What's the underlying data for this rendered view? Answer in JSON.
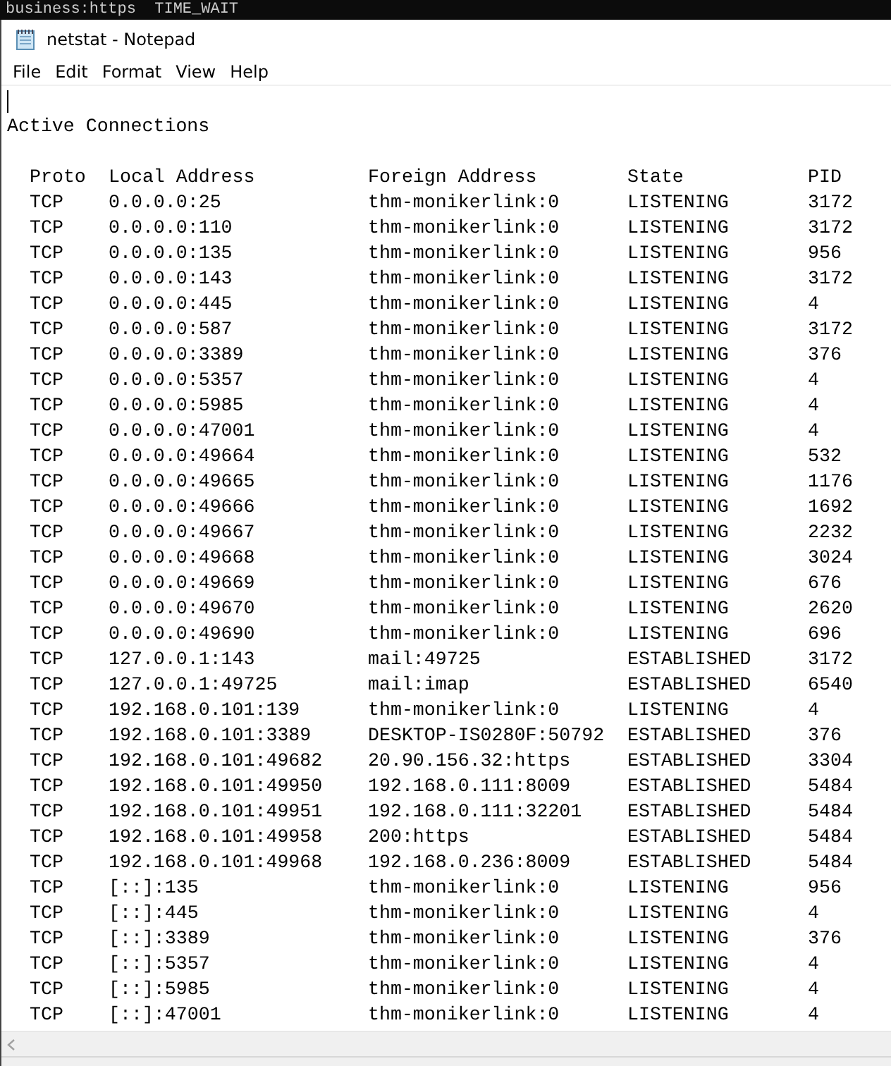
{
  "background_terminal": {
    "text": "business:https  TIME_WAIT"
  },
  "window": {
    "title": "netstat - Notepad"
  },
  "menu": [
    "File",
    "Edit",
    "Format",
    "View",
    "Help"
  ],
  "document": {
    "heading": "Active Connections",
    "columns": [
      "Proto",
      "Local Address",
      "Foreign Address",
      "State",
      "PID"
    ],
    "rows": [
      [
        "TCP",
        "0.0.0.0:25",
        "thm-monikerlink:0",
        "LISTENING",
        "3172"
      ],
      [
        "TCP",
        "0.0.0.0:110",
        "thm-monikerlink:0",
        "LISTENING",
        "3172"
      ],
      [
        "TCP",
        "0.0.0.0:135",
        "thm-monikerlink:0",
        "LISTENING",
        "956"
      ],
      [
        "TCP",
        "0.0.0.0:143",
        "thm-monikerlink:0",
        "LISTENING",
        "3172"
      ],
      [
        "TCP",
        "0.0.0.0:445",
        "thm-monikerlink:0",
        "LISTENING",
        "4"
      ],
      [
        "TCP",
        "0.0.0.0:587",
        "thm-monikerlink:0",
        "LISTENING",
        "3172"
      ],
      [
        "TCP",
        "0.0.0.0:3389",
        "thm-monikerlink:0",
        "LISTENING",
        "376"
      ],
      [
        "TCP",
        "0.0.0.0:5357",
        "thm-monikerlink:0",
        "LISTENING",
        "4"
      ],
      [
        "TCP",
        "0.0.0.0:5985",
        "thm-monikerlink:0",
        "LISTENING",
        "4"
      ],
      [
        "TCP",
        "0.0.0.0:47001",
        "thm-monikerlink:0",
        "LISTENING",
        "4"
      ],
      [
        "TCP",
        "0.0.0.0:49664",
        "thm-monikerlink:0",
        "LISTENING",
        "532"
      ],
      [
        "TCP",
        "0.0.0.0:49665",
        "thm-monikerlink:0",
        "LISTENING",
        "1176"
      ],
      [
        "TCP",
        "0.0.0.0:49666",
        "thm-monikerlink:0",
        "LISTENING",
        "1692"
      ],
      [
        "TCP",
        "0.0.0.0:49667",
        "thm-monikerlink:0",
        "LISTENING",
        "2232"
      ],
      [
        "TCP",
        "0.0.0.0:49668",
        "thm-monikerlink:0",
        "LISTENING",
        "3024"
      ],
      [
        "TCP",
        "0.0.0.0:49669",
        "thm-monikerlink:0",
        "LISTENING",
        "676"
      ],
      [
        "TCP",
        "0.0.0.0:49670",
        "thm-monikerlink:0",
        "LISTENING",
        "2620"
      ],
      [
        "TCP",
        "0.0.0.0:49690",
        "thm-monikerlink:0",
        "LISTENING",
        "696"
      ],
      [
        "TCP",
        "127.0.0.1:143",
        "mail:49725",
        "ESTABLISHED",
        "3172"
      ],
      [
        "TCP",
        "127.0.0.1:49725",
        "mail:imap",
        "ESTABLISHED",
        "6540"
      ],
      [
        "TCP",
        "192.168.0.101:139",
        "thm-monikerlink:0",
        "LISTENING",
        "4"
      ],
      [
        "TCP",
        "192.168.0.101:3389",
        "DESKTOP-IS0280F:50792",
        "ESTABLISHED",
        "376"
      ],
      [
        "TCP",
        "192.168.0.101:49682",
        "20.90.156.32:https",
        "ESTABLISHED",
        "3304"
      ],
      [
        "TCP",
        "192.168.0.101:49950",
        "192.168.0.111:8009",
        "ESTABLISHED",
        "5484"
      ],
      [
        "TCP",
        "192.168.0.101:49951",
        "192.168.0.111:32201",
        "ESTABLISHED",
        "5484"
      ],
      [
        "TCP",
        "192.168.0.101:49958",
        "200:https",
        "ESTABLISHED",
        "5484"
      ],
      [
        "TCP",
        "192.168.0.101:49968",
        "192.168.0.236:8009",
        "ESTABLISHED",
        "5484"
      ],
      [
        "TCP",
        "[::]:135",
        "thm-monikerlink:0",
        "LISTENING",
        "956"
      ],
      [
        "TCP",
        "[::]:445",
        "thm-monikerlink:0",
        "LISTENING",
        "4"
      ],
      [
        "TCP",
        "[::]:3389",
        "thm-monikerlink:0",
        "LISTENING",
        "376"
      ],
      [
        "TCP",
        "[::]:5357",
        "thm-monikerlink:0",
        "LISTENING",
        "4"
      ],
      [
        "TCP",
        "[::]:5985",
        "thm-monikerlink:0",
        "LISTENING",
        "4"
      ],
      [
        "TCP",
        "[::]:47001",
        "thm-monikerlink:0",
        "LISTENING",
        "4"
      ]
    ]
  }
}
